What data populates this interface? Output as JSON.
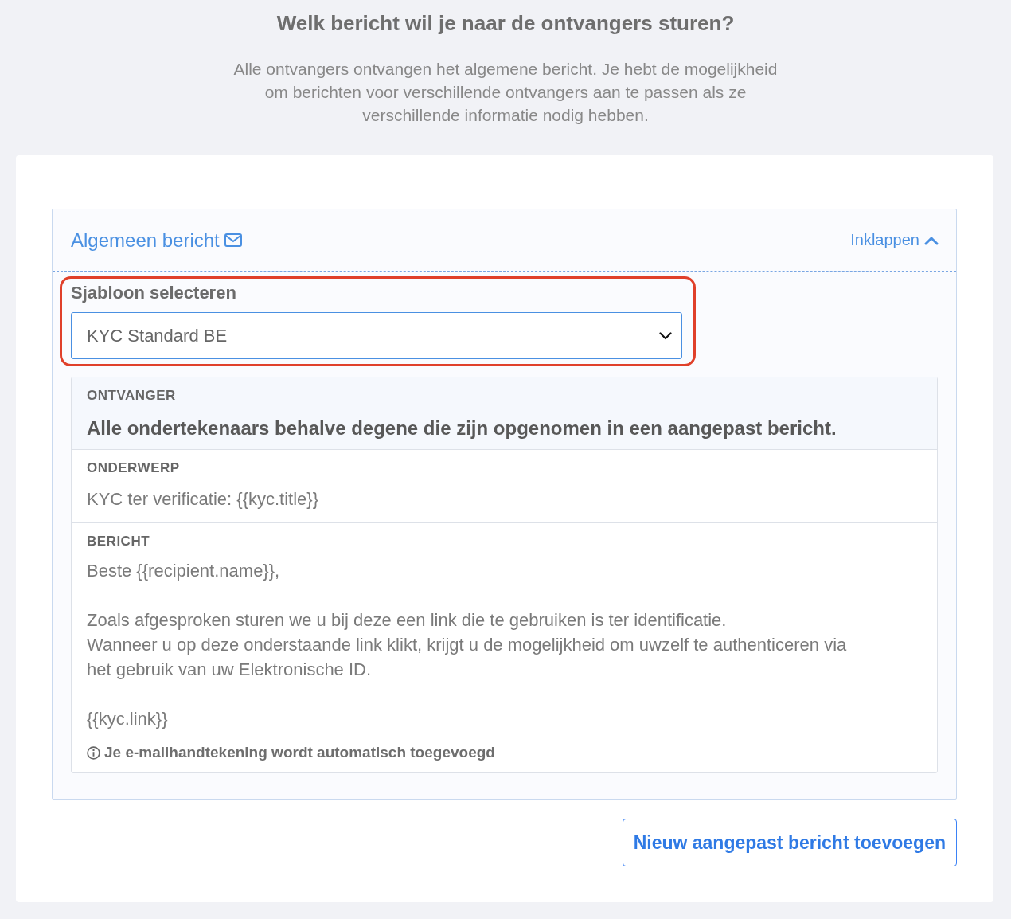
{
  "heading": "Welk bericht wil je naar de ontvangers sturen?",
  "description": "Alle ontvangers ontvangen het algemene bericht. Je hebt de mogelijkheid om berichten voor verschillende ontvangers aan te passen als ze verschillende informatie nodig hebben.",
  "general_message": {
    "title": "Algemeen bericht",
    "collapse_link": "Inklappen",
    "expanded": true,
    "template_select": {
      "label": "Sjabloon selecteren",
      "value": "KYC Standard BE",
      "highlighted": true
    },
    "recipient": {
      "label": "ONTVANGER",
      "value": "Alle ondertekenaars behalve degene die zijn opgenomen in een aangepast bericht."
    },
    "subject": {
      "label": "ONDERWERP",
      "value": "KYC ter verificatie: {{kyc.title}}"
    },
    "message": {
      "label": "BERICHT",
      "value": "Beste {{recipient.name}},\n\nZoals afgesproken sturen we u bij deze een link die te gebruiken is ter identificatie.\nWanneer u op deze onderstaande link klikt, krijgt u de mogelijkheid om uwzelf te authenticeren via het gebruik van uw Elektronische ID.\n\n{{kyc.link}}"
    },
    "signature_note": "Je e-mailhandtekening wordt automatisch toegevoegd"
  },
  "add_button": "Nieuw aangepast bericht toevoegen"
}
